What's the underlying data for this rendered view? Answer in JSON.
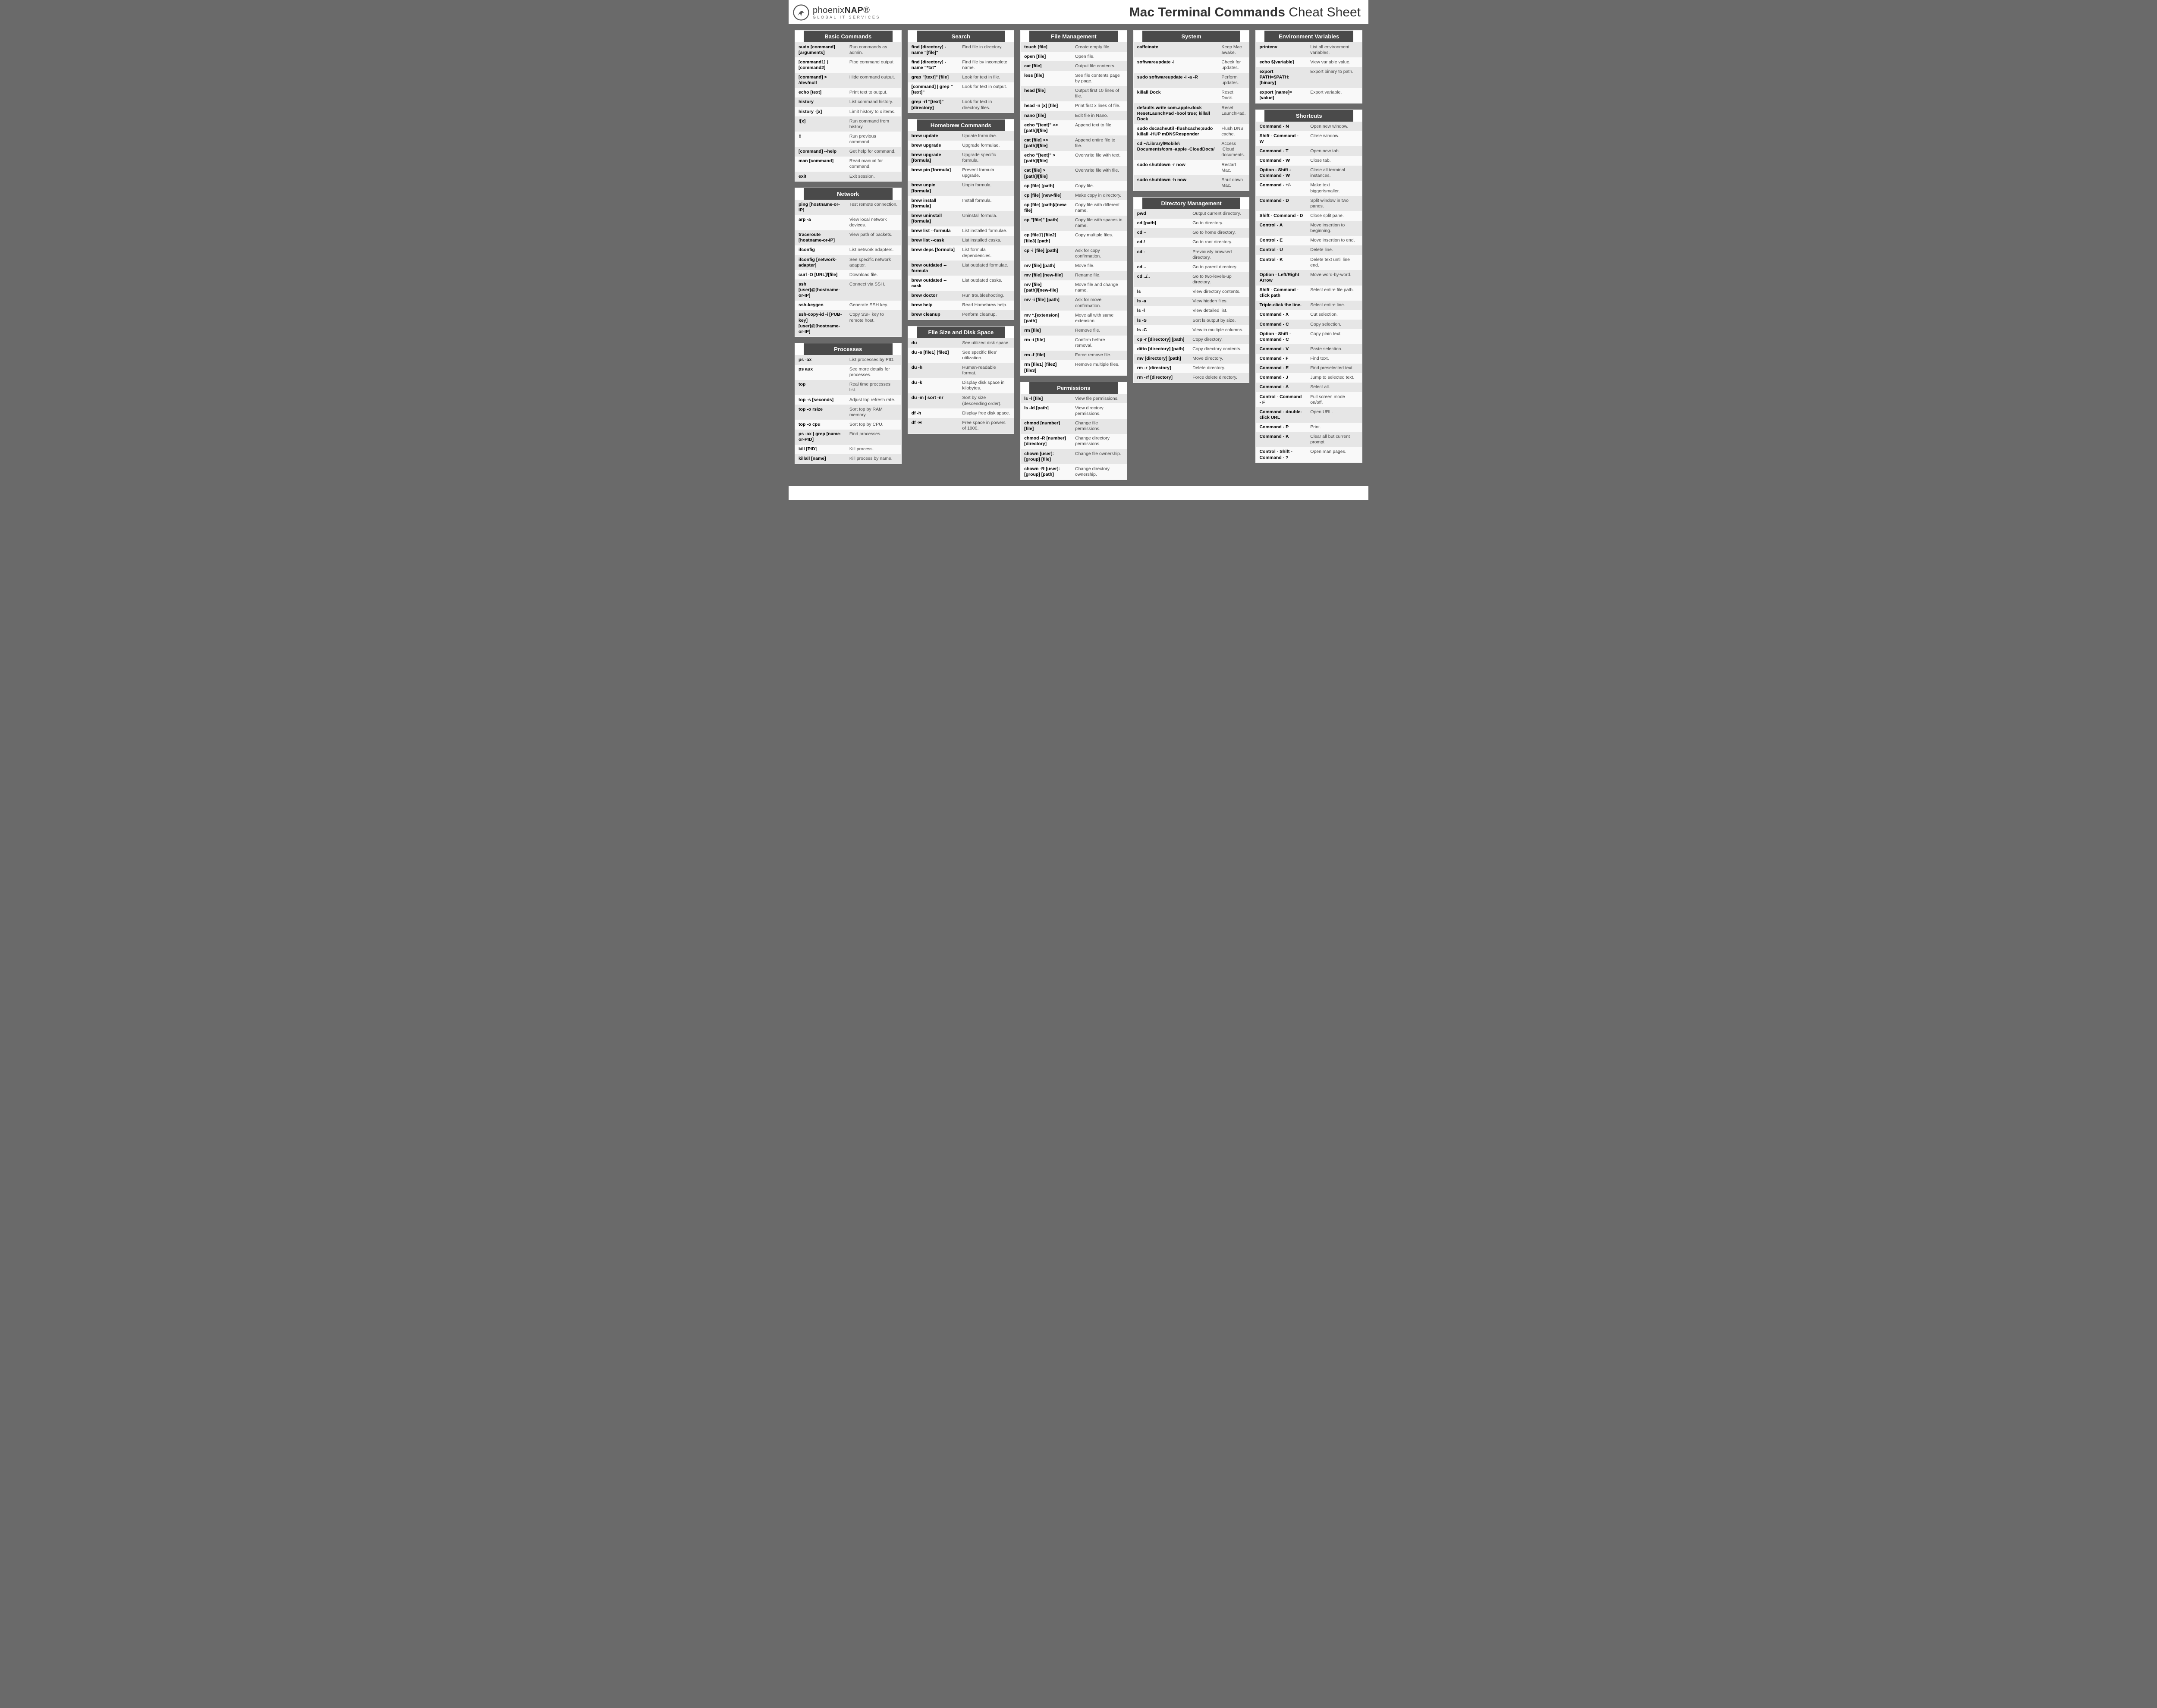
{
  "brand": {
    "name_thin": "phoenix",
    "name_bold": "NAP",
    "reg": "®",
    "sub": "GLOBAL IT SERVICES"
  },
  "title": {
    "bold": "Mac Terminal Commands",
    "light": " Cheat Sheet"
  },
  "columns": [
    [
      {
        "title": "Basic Commands",
        "rows": [
          [
            "sudo [command] [arguments]",
            "Run commands as admin."
          ],
          [
            "[command1] | [command2]",
            "Pipe command output."
          ],
          [
            "[command] > /dev/null",
            "Hide command output."
          ],
          [
            "echo [text]",
            "Print text to output."
          ],
          [
            "history",
            "List command history."
          ],
          [
            "history -[x]",
            "Limit history to x items."
          ],
          [
            "![x]",
            "Run command from history."
          ],
          [
            "!!",
            "Run previous command."
          ],
          [
            "[command] --help",
            "Get help for command."
          ],
          [
            "man [command]",
            "Read manual for command."
          ],
          [
            "exit",
            "Exit session."
          ]
        ]
      },
      {
        "title": "Network",
        "rows": [
          [
            "ping [hostname-or-IP]",
            "Test remote connection."
          ],
          [
            "arp -a",
            "View local network devices."
          ],
          [
            "traceroute [hostname-or-IP]",
            "View path of packets."
          ],
          [
            "ifconfig",
            "List network adapters."
          ],
          [
            "ifconfig [network-adapter]",
            "See specific network adapter."
          ],
          [
            "curl -O [URL]/[file]",
            "Download file."
          ],
          [
            "ssh [user]@[hostname-or-IP]",
            "Connect via SSH."
          ],
          [
            "ssh-keygen",
            "Generate SSH key."
          ],
          [
            "ssh-copy-id -i [PUB-key] [user]@[hostname-or-IP]",
            "Copy SSH key to remote host."
          ]
        ]
      },
      {
        "title": "Processes",
        "rows": [
          [
            "ps -ax",
            "List processes by PID."
          ],
          [
            "ps aux",
            "See more details for processes."
          ],
          [
            "top",
            "Real time processes list."
          ],
          [
            "top -s [seconds]",
            "Adjust top refresh rate."
          ],
          [
            "top -o rsize",
            "Sort top by RAM memory."
          ],
          [
            "top -o cpu",
            "Sort top by CPU."
          ],
          [
            "ps -ax | grep [name-or-PID]",
            "Find processes."
          ],
          [
            "kill [PID]",
            "Kill process."
          ],
          [
            "killall [name]",
            "Kill process by name."
          ]
        ]
      }
    ],
    [
      {
        "title": "Search",
        "rows": [
          [
            "find [directory] -name \"[file]\"",
            "Find file in directory."
          ],
          [
            "find [directory] -name \"*txt\"",
            "Find file by incomplete name."
          ],
          [
            "grep \"[text]\" [file]",
            "Look for text in file."
          ],
          [
            "[command] | grep \"[text]\"",
            "Look for text in output."
          ],
          [
            "grep -rl \"[text]\" [directory]",
            "Look for text in directory files."
          ]
        ]
      },
      {
        "title": "Homebrew Commands",
        "rows": [
          [
            "brew update",
            "Update formulae."
          ],
          [
            "brew upgrade",
            "Upgrade formulae."
          ],
          [
            "brew upgrade [formula]",
            "Upgrade specific formula."
          ],
          [
            "brew pin [formula]",
            "Prevent formula upgrade."
          ],
          [
            "brew unpin [formula]",
            "Unpin formula."
          ],
          [
            "brew install [formula]",
            "Install formula."
          ],
          [
            "brew uninstall [formula]",
            "Uninstall formula."
          ],
          [
            "brew list --formula",
            "List installed formulae."
          ],
          [
            "brew list --cask",
            "List installed casks."
          ],
          [
            "brew deps [formula]",
            "List formula dependencies."
          ],
          [
            "brew outdated --formula",
            "List outdated formulae."
          ],
          [
            "brew outdated --cask",
            "List outdated casks."
          ],
          [
            "brew doctor",
            "Run troubleshooting."
          ],
          [
            "brew help",
            "Read Homebrew help."
          ],
          [
            "brew cleanup",
            "Perform cleanup."
          ]
        ]
      },
      {
        "title": "File Size and Disk Space",
        "rows": [
          [
            "du",
            "See utilized disk space."
          ],
          [
            "du -s [file1] [file2]",
            "See specific files' utilization."
          ],
          [
            "du -h",
            "Human-readable format."
          ],
          [
            "du -k",
            "Display disk space in kilobytes."
          ],
          [
            "du -m | sort -nr",
            "Sort by size (descending order)."
          ],
          [
            "df -h",
            "Display free disk space."
          ],
          [
            "df -H",
            "Free space in powers of 1000."
          ]
        ]
      }
    ],
    [
      {
        "title": "File Management",
        "rows": [
          [
            "touch [file]",
            "Create empty file."
          ],
          [
            "open [file]",
            "Open file."
          ],
          [
            "cat [file]",
            "Output file contents."
          ],
          [
            "less [file]",
            "See file contents page by page."
          ],
          [
            "head [file]",
            "Output first 10 lines of file."
          ],
          [
            "head -n [x] [file]",
            "Print first x lines of file."
          ],
          [
            "nano [file]",
            "Edit file in Nano."
          ],
          [
            "echo \"[text]\" >> [path]/[file]",
            "Append text to file."
          ],
          [
            "cat [file] >> [path]/[file]",
            "Append entire file to file."
          ],
          [
            "echo \"[text]\" > [path]/[file]",
            "Overwrite file with text."
          ],
          [
            "cat [file] > [path]/[file]",
            "Overwrite file with file."
          ],
          [
            "cp [file] [path]",
            "Copy file."
          ],
          [
            "cp [file] [new-file]",
            "Make copy in directory."
          ],
          [
            "cp [file] [path]/[new-file]",
            "Copy file with different name."
          ],
          [
            "cp \"[file]\" [path]",
            "Copy file with spaces in name."
          ],
          [
            "cp [file1] [file2] [file3] [path]",
            "Copy multiple files."
          ],
          [
            "cp -i [file] [path]",
            "Ask for copy confirmation."
          ],
          [
            "mv [file] [path]",
            "Move file."
          ],
          [
            "mv [file] [new-file]",
            "Rename file."
          ],
          [
            "mv [file] [path]/[new-file]",
            "Move file and change name."
          ],
          [
            "mv -i [file] [path]",
            "Ask for move confirmation."
          ],
          [
            "mv *.[extension] [path]",
            "Move all with same extension."
          ],
          [
            "rm [file]",
            "Remove file."
          ],
          [
            "rm -i [file]",
            "Confirm before removal."
          ],
          [
            "rm -f [file]",
            "Force remove file."
          ],
          [
            "rm [file1] [file2] [file3]",
            "Remove multiple files."
          ]
        ]
      },
      {
        "title": "Permissions",
        "rows": [
          [
            "ls -l [file]",
            "View file permissions."
          ],
          [
            "ls -ld [path]",
            "View directory permissions."
          ],
          [
            "chmod [number] [file]",
            "Change file permissions."
          ],
          [
            "chmod -R [number] [directory]",
            "Change directory permissions."
          ],
          [
            "chown [user]:[group] [file]",
            "Change file ownership."
          ],
          [
            "chown -R [user]:[group] [path]",
            "Change directory ownership."
          ]
        ]
      }
    ],
    [
      {
        "title": "System",
        "rows": [
          [
            "caffeinate",
            "Keep Mac awake."
          ],
          [
            "softwareupdate -l",
            "Check for updates."
          ],
          [
            "sudo softwareupdate -i -a -R",
            "Perform updates."
          ],
          [
            "killall Dock",
            "Reset Dock."
          ],
          [
            "defaults write com.apple.dock ResetLaunchPad -bool true; killall Dock",
            "Reset LaunchPad."
          ],
          [
            "sudo dscacheutil -flushcache;sudo killall -HUP mDNSResponder",
            "Flush DNS cache."
          ],
          [
            "cd ~/Library/Mobile\\ Documents/com~apple~CloudDocs/",
            "Access iCloud documents."
          ],
          [
            "sudo shutdown -r now",
            "Restart Mac."
          ],
          [
            "sudo shutdown -h now",
            "Shut down Mac."
          ]
        ]
      },
      {
        "title": "Directory Management",
        "rows": [
          [
            "pwd",
            "Output current directory."
          ],
          [
            "cd [path]",
            "Go to directory."
          ],
          [
            "cd ~",
            "Go to home directory."
          ],
          [
            "cd /",
            "Go to root directory."
          ],
          [
            "cd -",
            "Previously browsed directory."
          ],
          [
            "cd ..",
            "Go to parent directory."
          ],
          [
            "cd ../..",
            "Go to two-levels-up directory."
          ],
          [
            "ls",
            "View directory contents."
          ],
          [
            "ls -a",
            "View hidden files."
          ],
          [
            "ls -l",
            "View detailed list."
          ],
          [
            "ls -S",
            "Sort ls output by size."
          ],
          [
            "ls -C",
            "View in multiple columns."
          ],
          [
            "cp -r [directory] [path]",
            "Copy directory."
          ],
          [
            "ditto [directory] [path]",
            "Copy directory contents."
          ],
          [
            "mv [directory] [path]",
            "Move directory."
          ],
          [
            "rm -r [directory]",
            "Delete directory."
          ],
          [
            "rm -rf [directory]",
            "Force delete directory."
          ]
        ]
      }
    ],
    [
      {
        "title": "Environment Variables",
        "rows": [
          [
            "printenv",
            "List all environment variables."
          ],
          [
            "echo $[variable]",
            "View variable value."
          ],
          [
            "export PATH=$PATH:[binary]",
            "Export binary to path."
          ],
          [
            "export [name]=[value]",
            "Export variable."
          ]
        ]
      },
      {
        "title": "Shortcuts",
        "rows": [
          [
            "Command - N",
            "Open new window."
          ],
          [
            "Shift - Command - W",
            "Close window."
          ],
          [
            "Command - T",
            "Open new tab."
          ],
          [
            "Command - W",
            "Close tab."
          ],
          [
            "Option - Shift - Command - W",
            "Close all terminal instances."
          ],
          [
            "Command - +/-",
            "Make text bigger/smaller."
          ],
          [
            "Command - D",
            "Split window in two panes."
          ],
          [
            "Shift - Command - D",
            "Close split pane."
          ],
          [
            "Control - A",
            "Move insertion to beginning."
          ],
          [
            "Control - E",
            "Move insertion to end."
          ],
          [
            "Control - U",
            "Delete line."
          ],
          [
            "Control - K",
            "Delete text until line end."
          ],
          [
            "Option - Left/Right Arrow",
            "Move word-by-word."
          ],
          [
            "Shift - Command - click path",
            "Select entire file path."
          ],
          [
            "Triple-click the line.",
            "Select entire line."
          ],
          [
            "Command - X",
            "Cut selection."
          ],
          [
            "Command - C",
            "Copy selection."
          ],
          [
            "Option - Shift - Command - C",
            "Copy plain text."
          ],
          [
            "Command - V",
            "Paste selection."
          ],
          [
            "Command - F",
            "Find text."
          ],
          [
            "Command - E",
            "Find preselected text."
          ],
          [
            "Command - J",
            "Jump to selected text."
          ],
          [
            "Command - A",
            "Select all."
          ],
          [
            "Control - Command - F",
            "Full screen mode on/off."
          ],
          [
            "Command - double-click URL",
            "Open URL."
          ],
          [
            "Command - P",
            "Print."
          ],
          [
            "Command - K",
            "Clear all but current prompt."
          ],
          [
            "Control - Shift - Command - ?",
            "Open man pages."
          ]
        ]
      }
    ]
  ]
}
